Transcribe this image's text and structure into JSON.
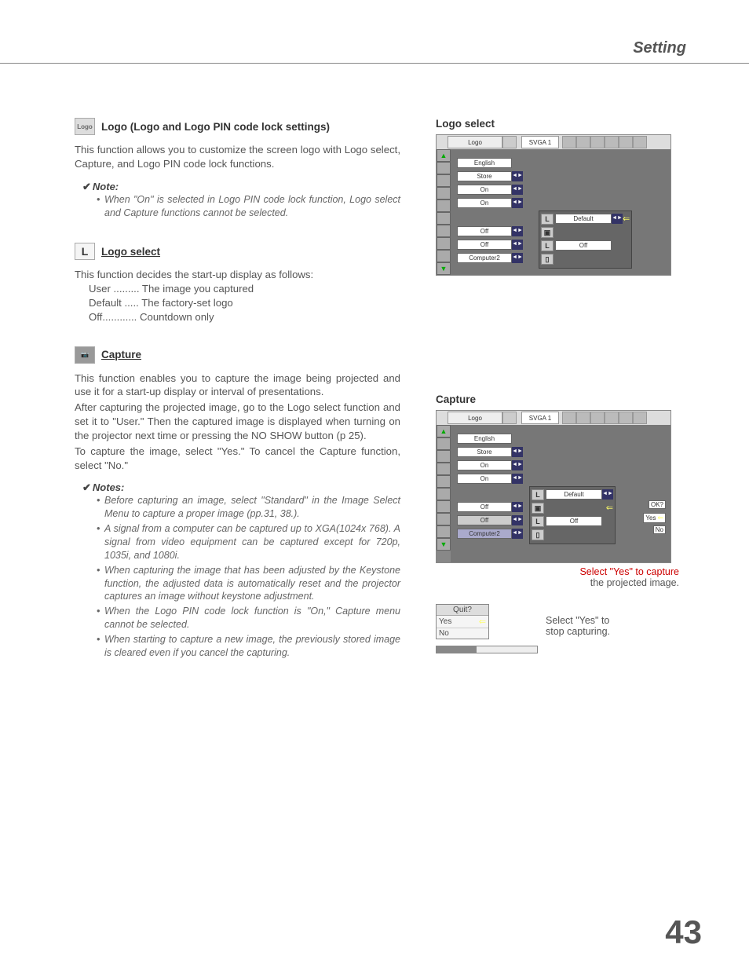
{
  "header": {
    "title": "Setting"
  },
  "pageNumber": "43",
  "logoSection": {
    "title": "Logo (Logo and Logo PIN code lock settings)",
    "body": "This function allows you to customize the screen logo with Logo select, Capture, and Logo PIN code lock functions.",
    "noteHead": "Note:",
    "noteBody": "When \"On\" is selected in Logo PIN code lock function, Logo select and Capture functions cannot be selected."
  },
  "logoSelect": {
    "title": "Logo select",
    "intro": "This function decides the start-up display as follows:",
    "opts": {
      "user": "User ......... The image you captured",
      "default": "Default ..... The factory-set logo",
      "off": "Off............ Countdown only"
    }
  },
  "capture": {
    "title": "Capture",
    "p1": "This function enables you to capture the image being projected and use it for a start-up display or interval of presentations.",
    "p2": "After capturing the projected image, go to the Logo select function and set it to \"User.\" Then the captured image is displayed when turning on the projector next time or pressing the NO SHOW button (p 25).",
    "p3": "To capture the image, select \"Yes.\" To cancel the Capture function, select \"No.\"",
    "notesHead": "Notes:",
    "notes": {
      "n1": "Before capturing an image, select \"Standard\" in the Image Select Menu to capture a proper image (pp.31, 38.).",
      "n2": "A signal from a computer can be captured up to XGA(1024x 768). A signal from video equipment can be captured except for 720p, 1035i, and 1080i.",
      "n3": "When capturing the image that has been adjusted by the Keystone function, the adjusted data is automatically reset and the projector captures an image without keystone adjustment.",
      "n4": "When the Logo PIN code lock function is \"On,\" Capture menu cannot be selected.",
      "n5": "When starting to capture a new image, the previously stored image is cleared even if you cancel the capturing."
    }
  },
  "figures": {
    "logoSelectLabel": "Logo select",
    "captureLabel": "Capture",
    "menu": {
      "logo": "Logo",
      "svga": "SVGA 1",
      "english": "English",
      "store": "Store",
      "on": "On",
      "off": "Off",
      "computer2": "Computer2",
      "default": "Default"
    },
    "captureCaption1": "Select \"Yes\" to capture",
    "captureCaption2": "the projected image.",
    "ok": "OK?",
    "yes": "Yes",
    "no": "No",
    "quit": "Quit?",
    "quitCaption1": "Select \"Yes\" to",
    "quitCaption2": "stop capturing."
  }
}
